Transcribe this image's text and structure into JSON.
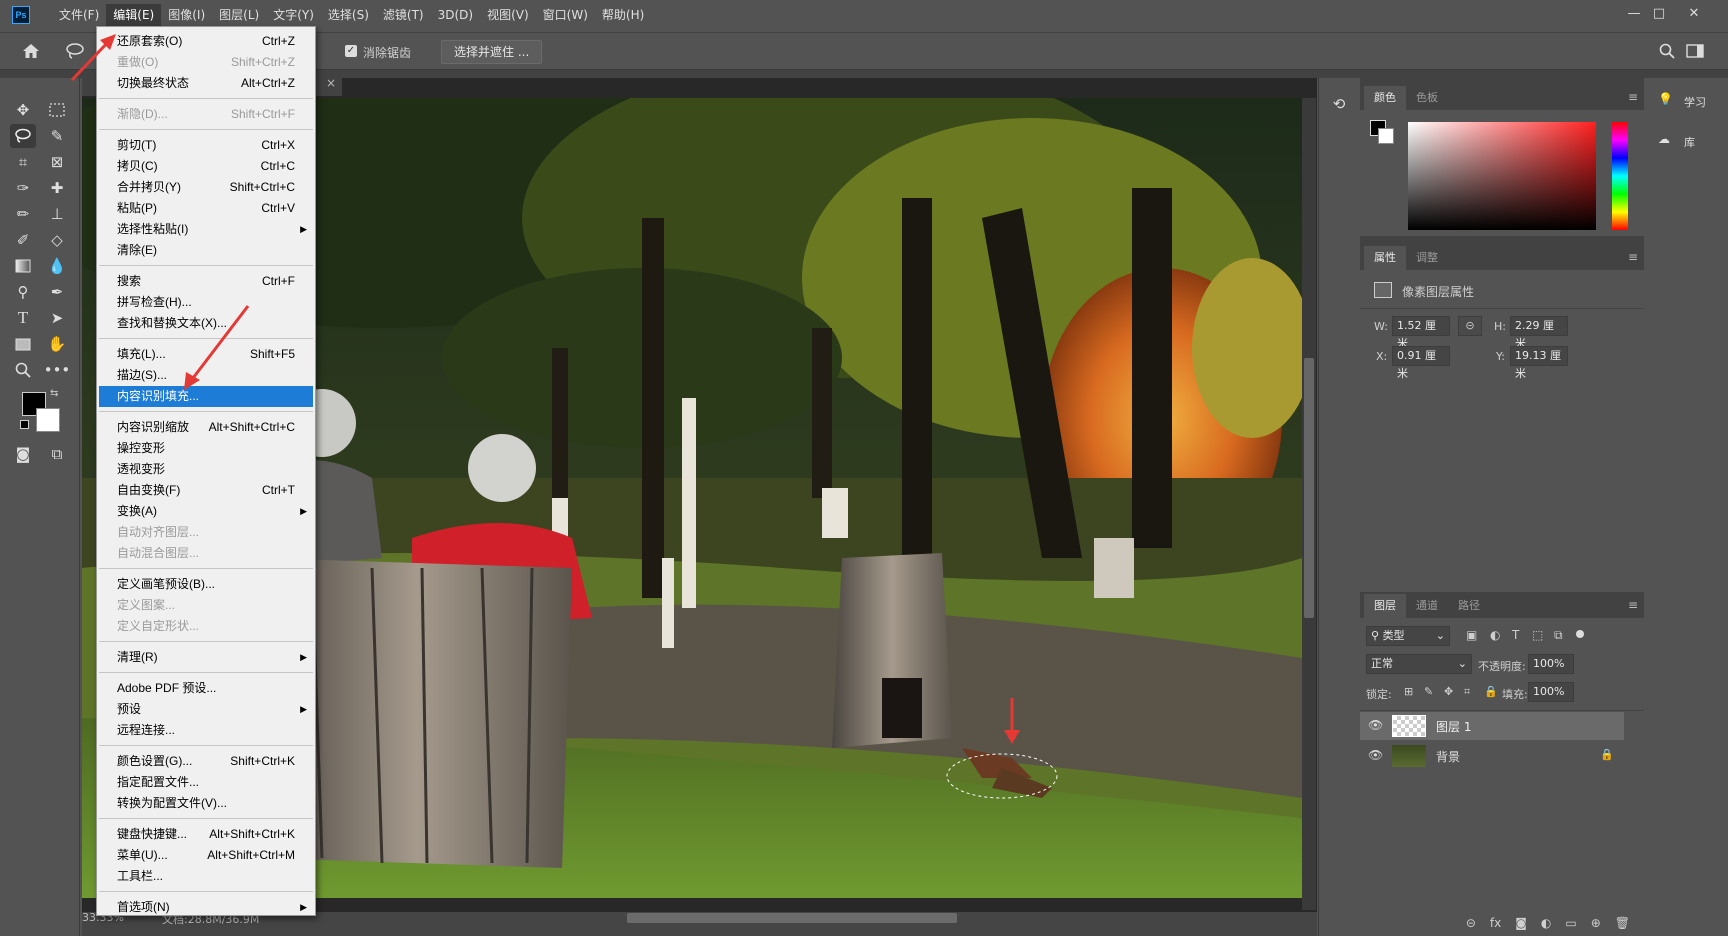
{
  "menubar": {
    "items": [
      "文件(F)",
      "编辑(E)",
      "图像(I)",
      "图层(L)",
      "文字(Y)",
      "选择(S)",
      "滤镜(T)",
      "3D(D)",
      "视图(V)",
      "窗口(W)",
      "帮助(H)"
    ],
    "active_index": 1,
    "logo": "Ps"
  },
  "window_controls": {
    "minimize": "—",
    "maximize": "□",
    "close": "✕"
  },
  "options": {
    "antialias_label": "消除锯齿",
    "select_mask_button": "选择并遮住 ..."
  },
  "dropdown": {
    "items": [
      {
        "label": "还原套索(O)",
        "shortcut": "Ctrl+Z",
        "disabled": false
      },
      {
        "label": "重做(O)",
        "shortcut": "Shift+Ctrl+Z",
        "disabled": true
      },
      {
        "label": "切换最终状态",
        "shortcut": "Alt+Ctrl+Z",
        "disabled": false
      },
      {
        "sep": true
      },
      {
        "label": "渐隐(D)...",
        "shortcut": "Shift+Ctrl+F",
        "disabled": true
      },
      {
        "sep": true
      },
      {
        "label": "剪切(T)",
        "shortcut": "Ctrl+X",
        "disabled": false
      },
      {
        "label": "拷贝(C)",
        "shortcut": "Ctrl+C",
        "disabled": false
      },
      {
        "label": "合并拷贝(Y)",
        "shortcut": "Shift+Ctrl+C",
        "disabled": false
      },
      {
        "label": "粘贴(P)",
        "shortcut": "Ctrl+V",
        "disabled": false
      },
      {
        "label": "选择性粘贴(I)",
        "shortcut": "",
        "submenu": true,
        "disabled": false
      },
      {
        "label": "清除(E)",
        "shortcut": "",
        "disabled": false
      },
      {
        "sep": true
      },
      {
        "label": "搜索",
        "shortcut": "Ctrl+F",
        "disabled": false
      },
      {
        "label": "拼写检查(H)...",
        "shortcut": "",
        "disabled": false
      },
      {
        "label": "查找和替换文本(X)...",
        "shortcut": "",
        "disabled": false
      },
      {
        "sep": true
      },
      {
        "label": "填充(L)...",
        "shortcut": "Shift+F5",
        "disabled": false
      },
      {
        "label": "描边(S)...",
        "shortcut": "",
        "disabled": false
      },
      {
        "label": "内容识别填充...",
        "shortcut": "",
        "disabled": false,
        "highlighted": true
      },
      {
        "sep": true
      },
      {
        "label": "内容识别缩放",
        "shortcut": "Alt+Shift+Ctrl+C",
        "disabled": false
      },
      {
        "label": "操控变形",
        "shortcut": "",
        "disabled": false
      },
      {
        "label": "透视变形",
        "shortcut": "",
        "disabled": false
      },
      {
        "label": "自由变换(F)",
        "shortcut": "Ctrl+T",
        "disabled": false
      },
      {
        "label": "变换(A)",
        "shortcut": "",
        "submenu": true,
        "disabled": false
      },
      {
        "label": "自动对齐图层...",
        "shortcut": "",
        "disabled": true
      },
      {
        "label": "自动混合图层...",
        "shortcut": "",
        "disabled": true
      },
      {
        "sep": true
      },
      {
        "label": "定义画笔预设(B)...",
        "shortcut": "",
        "disabled": false
      },
      {
        "label": "定义图案...",
        "shortcut": "",
        "disabled": true
      },
      {
        "label": "定义自定形状...",
        "shortcut": "",
        "disabled": true
      },
      {
        "sep": true
      },
      {
        "label": "清理(R)",
        "shortcut": "",
        "submenu": true,
        "disabled": false
      },
      {
        "sep": true
      },
      {
        "label": "Adobe PDF 预设...",
        "shortcut": "",
        "disabled": false
      },
      {
        "label": "预设",
        "shortcut": "",
        "submenu": true,
        "disabled": false
      },
      {
        "label": "远程连接...",
        "shortcut": "",
        "disabled": false
      },
      {
        "sep": true
      },
      {
        "label": "颜色设置(G)...",
        "shortcut": "Shift+Ctrl+K",
        "disabled": false
      },
      {
        "label": "指定配置文件...",
        "shortcut": "",
        "disabled": false
      },
      {
        "label": "转换为配置文件(V)...",
        "shortcut": "",
        "disabled": false
      },
      {
        "sep": true
      },
      {
        "label": "键盘快捷键...",
        "shortcut": "Alt+Shift+Ctrl+K",
        "disabled": false
      },
      {
        "label": "菜单(U)...",
        "shortcut": "Alt+Shift+Ctrl+M",
        "disabled": false
      },
      {
        "label": "工具栏...",
        "shortcut": "",
        "disabled": false
      },
      {
        "sep": true
      },
      {
        "label": "首选项(N)",
        "shortcut": "",
        "submenu": true,
        "disabled": false
      }
    ]
  },
  "status": {
    "zoom": "33.33%",
    "doc_info": "文档:28.8M/36.9M"
  },
  "doc_tab_close": "×",
  "color_panel": {
    "tabs": [
      "颜色",
      "色板"
    ]
  },
  "properties_panel": {
    "tabs": [
      "属性",
      "调整"
    ],
    "title": "像素图层属性",
    "w_label": "W:",
    "w_value": "1.52 厘米",
    "h_label": "H:",
    "h_value": "2.29 厘米",
    "x_label": "X:",
    "x_value": "0.91 厘米",
    "y_label": "Y:",
    "y_value": "19.13 厘米"
  },
  "layers_panel": {
    "tabs": [
      "图层",
      "通道",
      "路径"
    ],
    "filter": "类型",
    "blend_mode": "正常",
    "opacity_label": "不透明度:",
    "opacity": "100%",
    "lock_label": "锁定:",
    "fill_label": "填充:",
    "fill": "100%",
    "layers": [
      {
        "name": "图层 1",
        "selected": true,
        "locked": false
      },
      {
        "name": "背景",
        "selected": false,
        "locked": true
      }
    ]
  },
  "right_dock": {
    "learn": "学习",
    "library": "库"
  },
  "colors": {
    "menu_highlight": "#1c7cd6",
    "ui_bg": "#535353",
    "panel_dark": "#424242",
    "arrow_red": "#e53935"
  }
}
